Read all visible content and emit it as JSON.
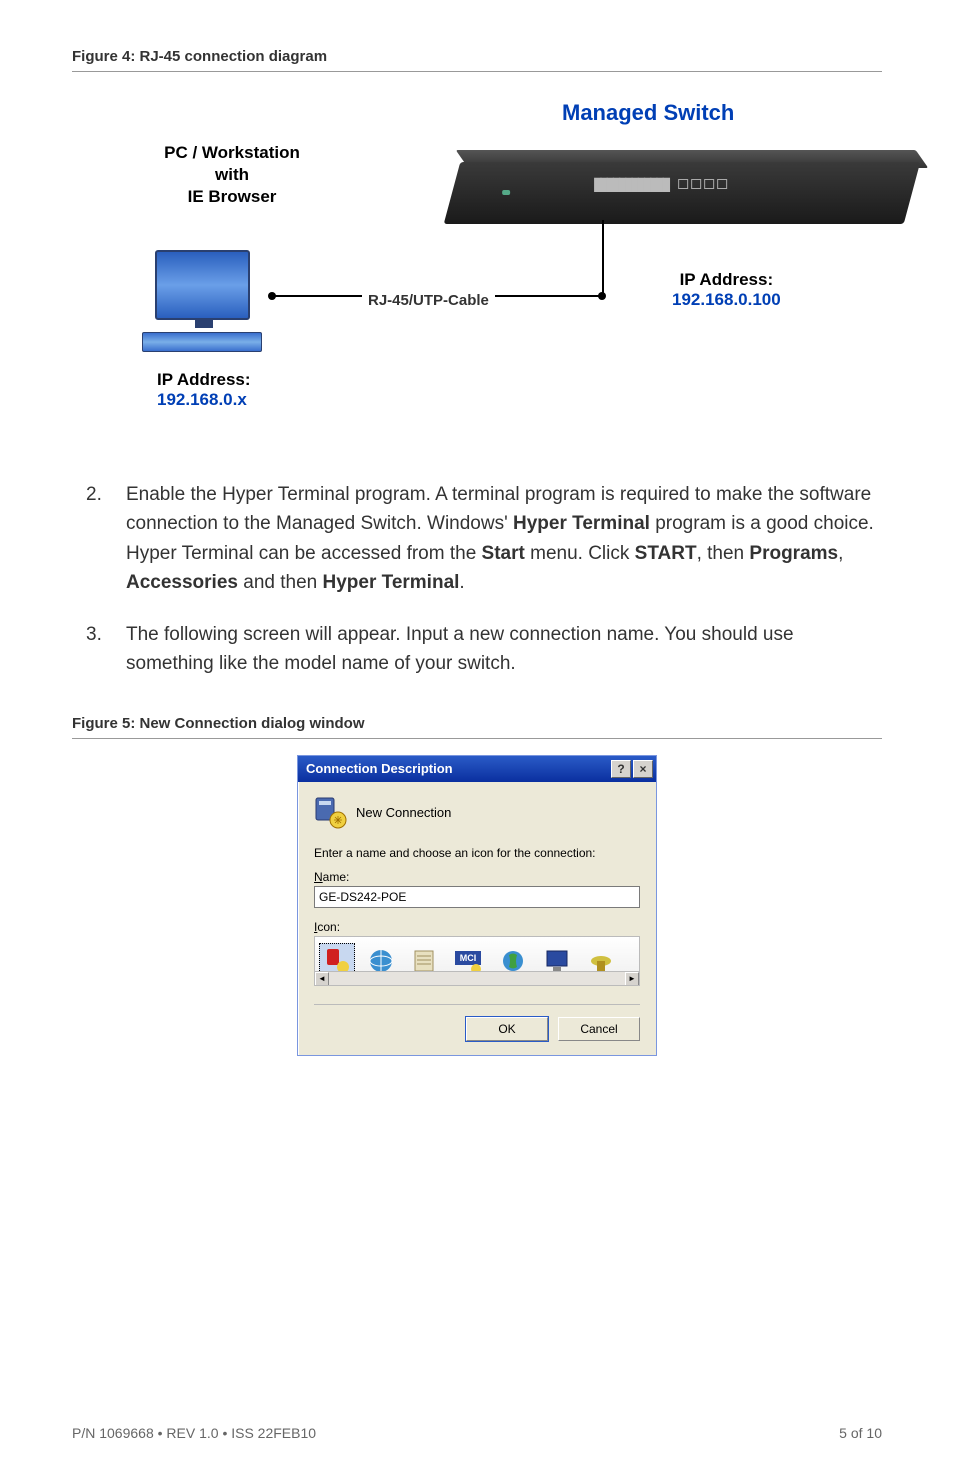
{
  "figure4": {
    "caption": "Figure 4: RJ-45 connection diagram",
    "managed_title": "Managed Switch",
    "pc_label_l1": "PC / Workstation",
    "pc_label_l2": "with",
    "pc_label_l3": "IE Browser",
    "cable_label": "RJ-45/UTP-Cable",
    "ip_left_label": "IP Address:",
    "ip_left_value": "192.168.0.x",
    "ip_right_label": "IP Address:",
    "ip_right_value": "192.168.0.100"
  },
  "steps": [
    {
      "num": "2.",
      "segments": [
        {
          "t": "Enable the Hyper Terminal program. A terminal program is required to make the software connection to the Managed Switch. Windows' "
        },
        {
          "t": "Hyper Terminal",
          "b": true
        },
        {
          "t": " program is a good choice. Hyper Terminal can be accessed from the "
        },
        {
          "t": "Start",
          "b": true
        },
        {
          "t": " menu. Click "
        },
        {
          "t": "START",
          "b": true
        },
        {
          "t": ", then "
        },
        {
          "t": "Programs",
          "b": true
        },
        {
          "t": ", "
        },
        {
          "t": "Accessories",
          "b": true
        },
        {
          "t": " and then "
        },
        {
          "t": "Hyper Terminal",
          "b": true
        },
        {
          "t": "."
        }
      ]
    },
    {
      "num": "3.",
      "segments": [
        {
          "t": "The following screen will appear. Input a new connection name. You should use something like the model name of your switch."
        }
      ]
    }
  ],
  "figure5": {
    "caption": "Figure 5: New Connection dialog window"
  },
  "dialog": {
    "title": "Connection Description",
    "help_btn": "?",
    "close_btn": "×",
    "new_conn_label": "New Connection",
    "prompt": "Enter a name and choose an icon for the connection:",
    "name_label": "Name:",
    "name_value": "GE-DS242-POE",
    "icon_label": "Icon:",
    "scroll_left": "◄",
    "scroll_right": "►",
    "ok": "OK",
    "cancel": "Cancel"
  },
  "footer": {
    "left": "P/N 1069668 • REV 1.0 • ISS 22FEB10",
    "right": "5 of 10"
  }
}
